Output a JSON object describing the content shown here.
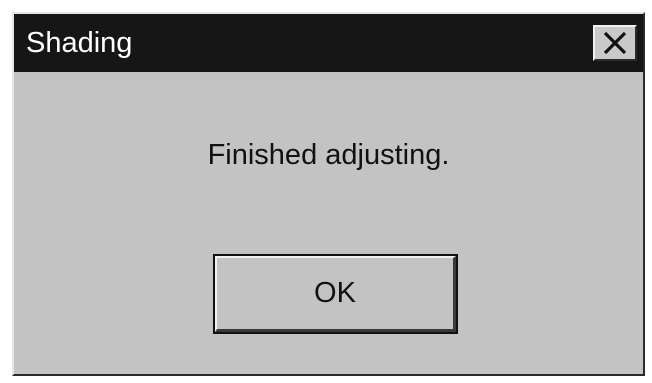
{
  "dialog": {
    "title": "Shading",
    "message": "Finished adjusting.",
    "ok_label": "OK"
  },
  "icons": {
    "close": "close-icon"
  },
  "colors": {
    "titlebar": "#161616",
    "body": "#c3c3c3",
    "title_text": "#ffffff"
  }
}
